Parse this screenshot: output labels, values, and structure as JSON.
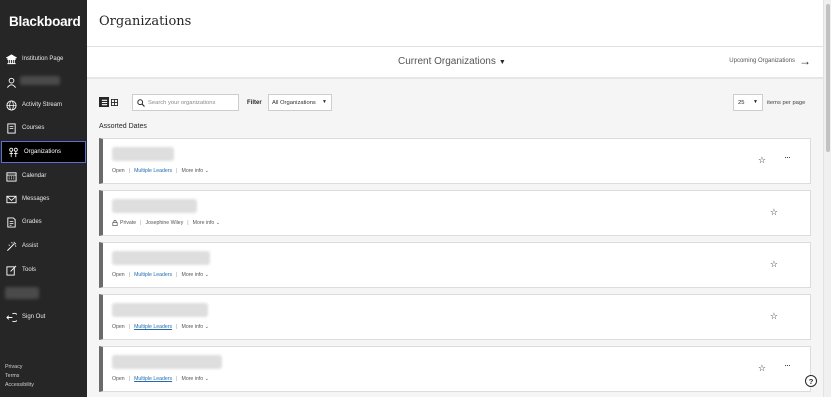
{
  "sidebar": {
    "brand": "Blackboard",
    "items": [
      {
        "label": "Institution Page",
        "icon": "institution-icon"
      },
      {
        "label": "",
        "icon": "user-icon"
      },
      {
        "label": "Activity Stream",
        "icon": "globe-icon"
      },
      {
        "label": "Courses",
        "icon": "courses-icon"
      },
      {
        "label": "Organizations",
        "icon": "organizations-icon"
      },
      {
        "label": "Calendar",
        "icon": "calendar-icon"
      },
      {
        "label": "Messages",
        "icon": "envelope-icon"
      },
      {
        "label": "Grades",
        "icon": "grades-icon"
      },
      {
        "label": "Assist",
        "icon": "assist-icon"
      },
      {
        "label": "Tools",
        "icon": "tools-icon"
      },
      {
        "label": "Sign Out",
        "icon": "sign-out-icon"
      }
    ],
    "footer": {
      "privacy": "Privacy",
      "terms": "Terms",
      "accessibility": "Accessibility"
    }
  },
  "header": {
    "title": "Organizations"
  },
  "org_switch": {
    "current": "Current Organizations",
    "upcoming": "Upcoming Organizations"
  },
  "toolbar": {
    "search_placeholder": "Search your organizations",
    "filter_label": "Filter",
    "filter_value": "All Organizations",
    "per_page_value": "25",
    "per_page_label": "items per page"
  },
  "section": {
    "title": "Assorted Dates"
  },
  "cards": [
    {
      "status": "Open",
      "leader": "Multiple Leaders",
      "more": "More info"
    },
    {
      "status": "Private",
      "leader": "Josephine Wiley",
      "more": "More info"
    },
    {
      "status": "Open",
      "leader": "Multiple Leaders",
      "more": "More info"
    },
    {
      "status": "Open",
      "leader": "Multiple Leaders",
      "more": "More info"
    },
    {
      "status": "Open",
      "leader": "Multiple Leaders",
      "more": "More info"
    }
  ],
  "colors": {
    "sidebar_bg": "#262626",
    "link": "#1f6cb0",
    "active_border": "#5a6fd6"
  }
}
